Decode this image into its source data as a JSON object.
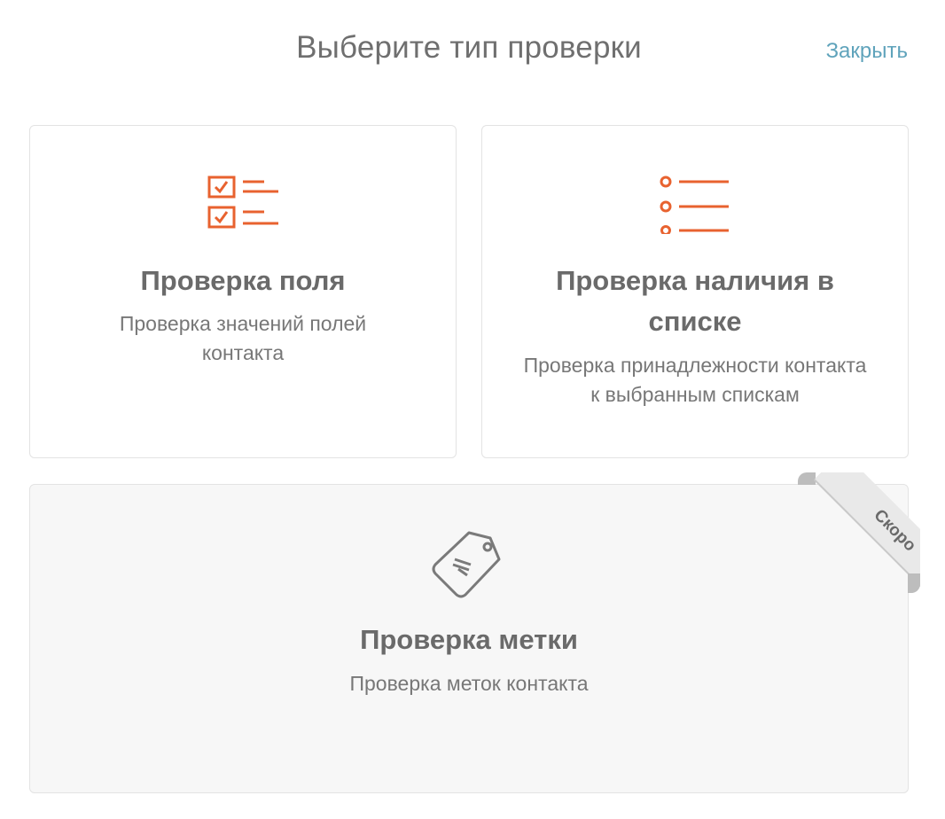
{
  "header": {
    "title": "Выберите тип проверки",
    "close_label": "Закрыть"
  },
  "cards": [
    {
      "icon": "checklist-icon",
      "title": "Проверка поля",
      "description": "Проверка значений полей контакта",
      "enabled": true
    },
    {
      "icon": "bullet-list-icon",
      "title": "Проверка наличия в списке",
      "description": "Проверка принадлежности контакта к выбранным спискам",
      "enabled": true
    },
    {
      "icon": "tag-icon",
      "title": "Проверка метки",
      "description": "Проверка меток контакта",
      "enabled": false,
      "badge": "Скоро"
    }
  ],
  "colors": {
    "accent_icon": "#e8622f",
    "link": "#5fa3bb",
    "disabled_bg": "#f7f7f7"
  }
}
